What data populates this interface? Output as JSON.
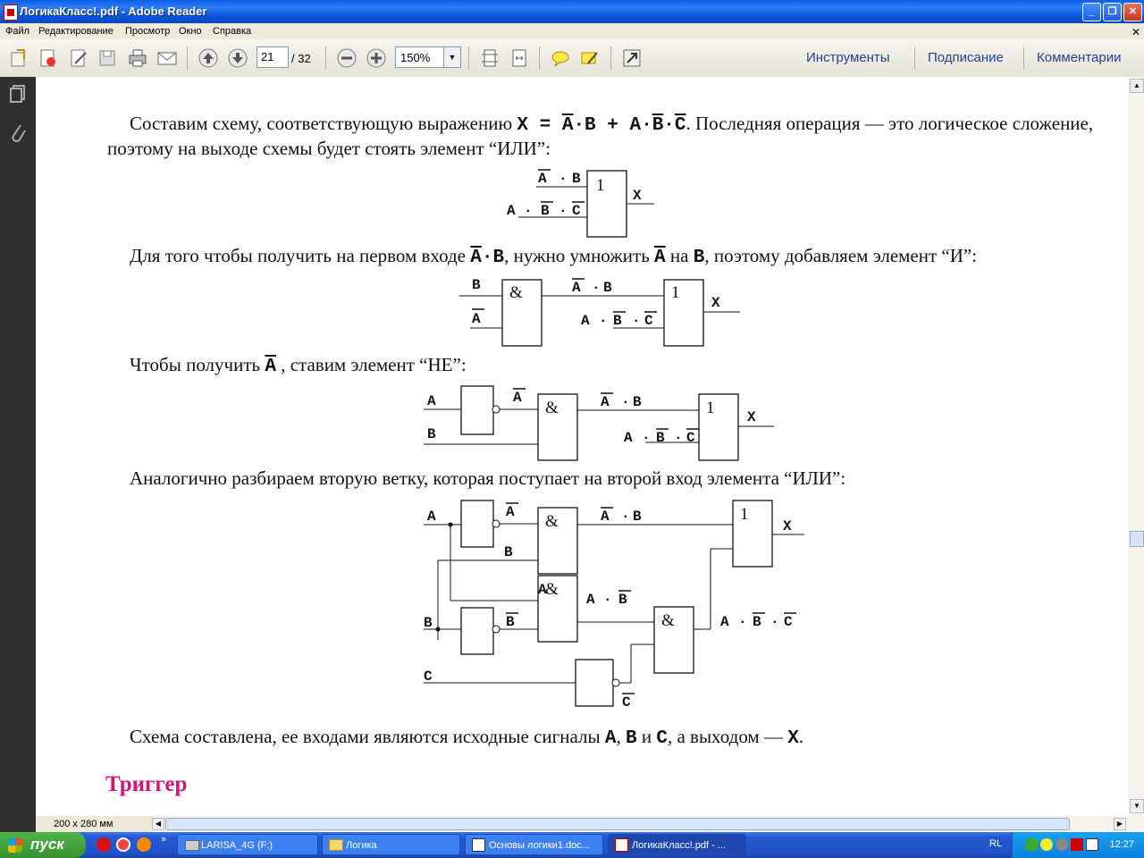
{
  "window": {
    "title": "ЛогикаКласс!.pdf - Adobe Reader"
  },
  "menu": [
    "Файл",
    "Редактирование",
    "Просмотр",
    "Окно",
    "Справка"
  ],
  "toolbar": {
    "page_current": "21",
    "page_total": "/ 32",
    "zoom": "150%",
    "right_tools": [
      "Инструменты",
      "Подписание",
      "Комментарии"
    ]
  },
  "doc": {
    "p1_line1": "Составим схему, соответствующую выражению",
    "p1_expr_prefix": "X",
    "p1_line1_end": ". Последняя операция — это логическое сложение,",
    "p1_line2": "поэтому на выходе схемы будет стоять элемент “ИЛИ”:",
    "p2_a": "Для того чтобы получить на первом входе",
    "p2_b": ", нужно умножить",
    "p2_c": "на",
    "p2_d": ", поэтому добавляем элемент “И”:",
    "p3_a": "Чтобы получить",
    "p3_b": ", ставим элемент “НЕ”:",
    "p4": "Аналогично разбираем вторую ветку, которая поступает на второй вход элемента “ИЛИ”:",
    "p5_a": "Схема составлена, ее входами являются исходные сигналы",
    "p5_b": "и",
    "p5_c": ", а выходом —",
    "heading": "Триггер",
    "vars": {
      "A": "A",
      "B": "B",
      "C": "C",
      "X": "X",
      "dot": "·",
      "comma": ",",
      "period": "."
    },
    "gates": {
      "or": "1",
      "and": "&"
    }
  },
  "status": {
    "page_size": "200 x 280 мм"
  },
  "taskbar": {
    "start": "пуск",
    "tasks": [
      "LARISA_4G (F:)",
      "Логика",
      "Основы логики1.doc...",
      "ЛогикаКласс!.pdf - ..."
    ],
    "lang": "RL",
    "clock": "12:27"
  },
  "colors": {
    "heading": "#d3157a",
    "titlebar": "#0a5ee8",
    "taskbar": "#2558d0",
    "start": "#37932f"
  }
}
